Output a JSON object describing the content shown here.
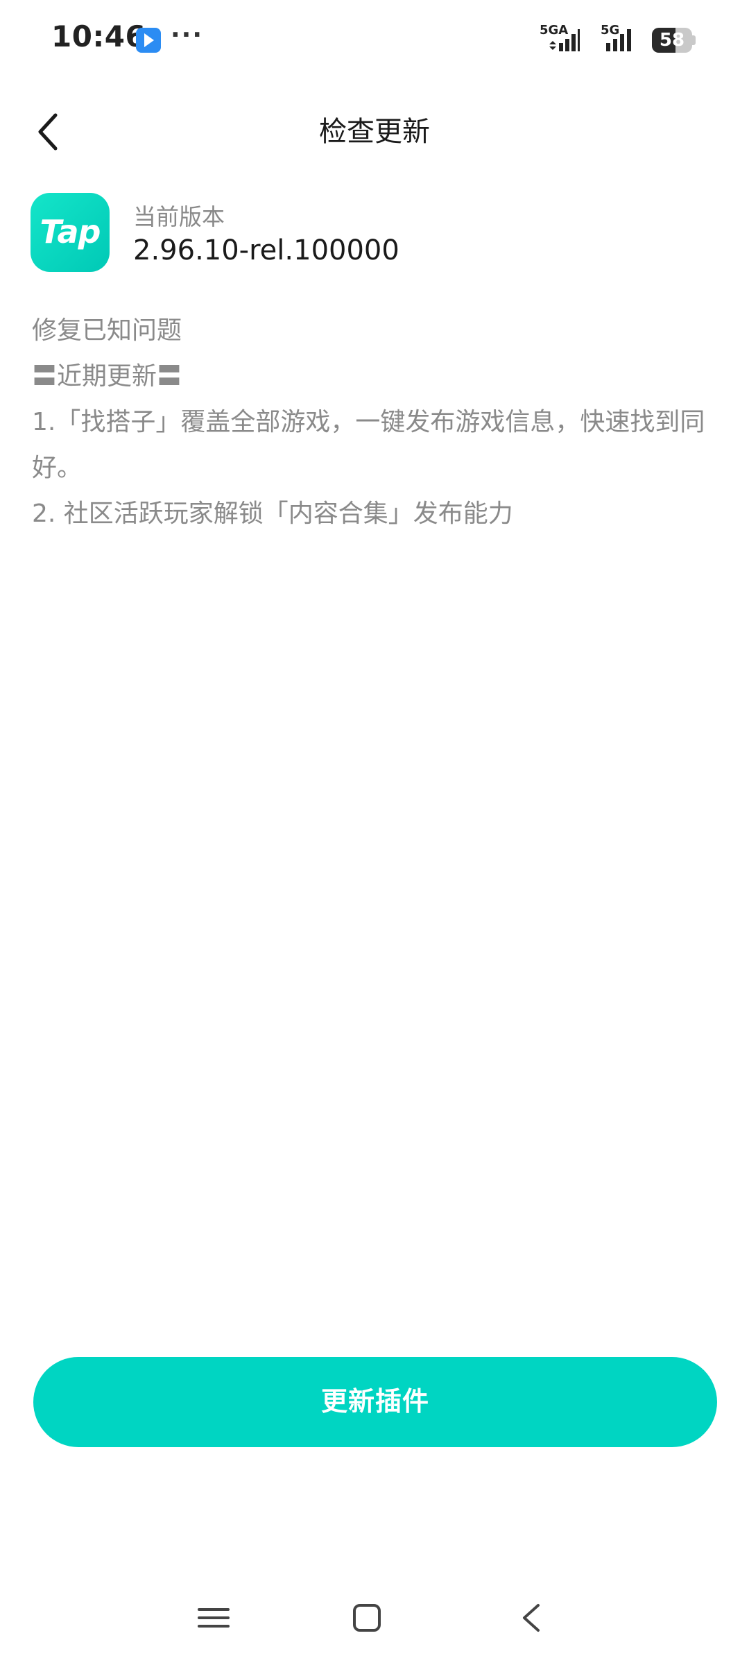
{
  "status_bar": {
    "time": "10:46",
    "more": "···",
    "network_1": "5GA",
    "network_2": "5G",
    "battery_level": 58,
    "battery_text": "58"
  },
  "header": {
    "title": "检查更新",
    "back_icon": "chevron-left-icon"
  },
  "app": {
    "logo_text": "Tap",
    "logo_color": "#00d5c2",
    "version_label": "当前版本",
    "version_value": "2.96.10-rel.100000"
  },
  "notes": {
    "lines": [
      "修复已知问题",
      "〓近期更新〓",
      "1.「找搭子」覆盖全部游戏，一键发布游戏信息，快速找到同好。",
      "2. 社区活跃玩家解锁「内容合集」发布能力"
    ]
  },
  "actions": {
    "update_button": "更新插件",
    "accent_color": "#00d5c2"
  },
  "nav_bar": {
    "menu_icon": "menu-icon",
    "home_icon": "home-square-icon",
    "back_icon": "back-triangle-icon"
  }
}
